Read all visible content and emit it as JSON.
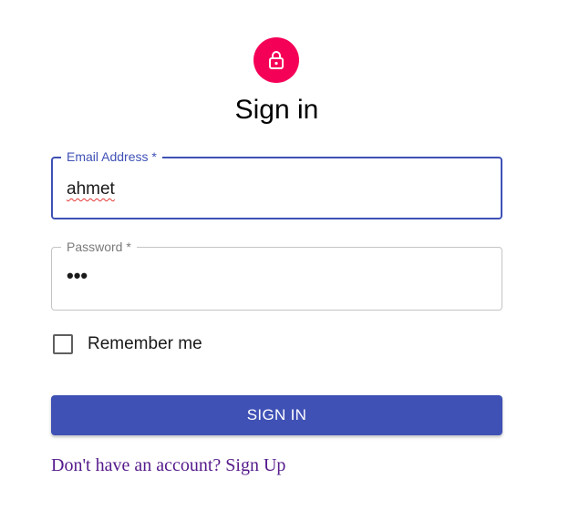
{
  "header": {
    "avatar_icon": "lock-icon",
    "avatar_color": "#f50057",
    "title": "Sign in"
  },
  "form": {
    "email": {
      "label": "Email Address *",
      "value": "ahmet"
    },
    "password": {
      "label": "Password *",
      "value": "•••"
    },
    "remember": {
      "label": "Remember me",
      "checked": false
    },
    "submit_label": "SIGN IN"
  },
  "footer": {
    "signup_link": "Don't have an account? Sign Up"
  },
  "colors": {
    "primary": "#3f51b5",
    "secondary": "#f50057",
    "link": "#551a8b"
  }
}
